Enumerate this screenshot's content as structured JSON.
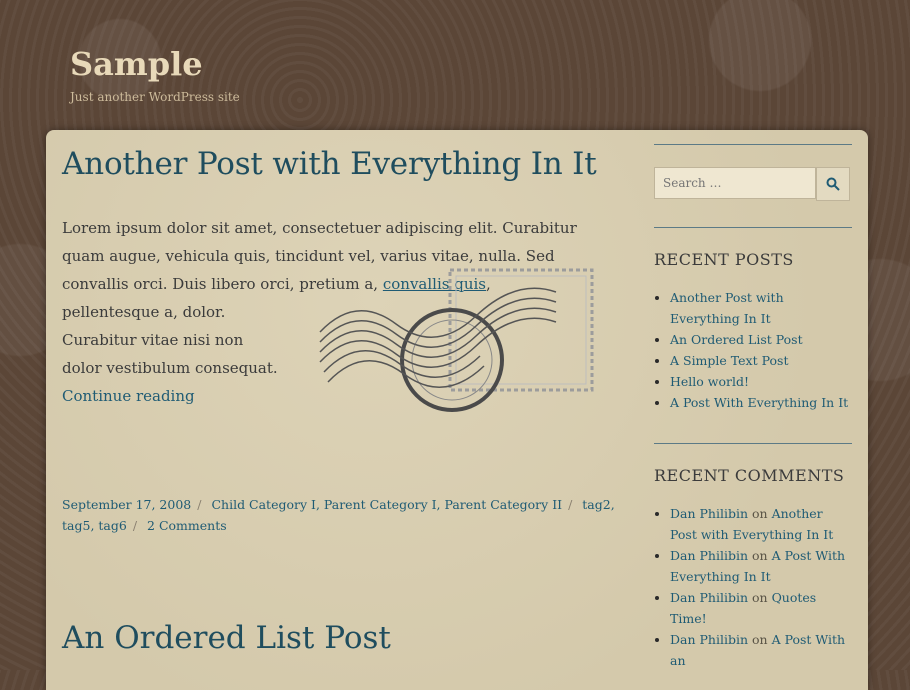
{
  "site": {
    "title": "Sample",
    "description": "Just another WordPress site"
  },
  "post": {
    "title": "Another Post with Everything In It",
    "para_1": "Lorem ipsum dolor sit amet, consectetuer adipiscing elit. Curabitur quam augue, vehicula quis, tincidunt vel, varius vitae, nulla. Sed convallis orci. Duis libero orci, pretium a,",
    "link": "convallis quis",
    "para_2": "pellentesque a, dolor. Curabitur vitae nisi non dolor vestibulum consequat.",
    "continue": "Continue reading",
    "date": "September 17, 2008",
    "categories": [
      "Child Category I",
      "Parent Category I",
      "Parent Category II"
    ],
    "tags": [
      "tag2",
      "tag5",
      "tag6"
    ],
    "comments": "2 Comments"
  },
  "next_post": {
    "title": "An Ordered List Post"
  },
  "search": {
    "placeholder": "Search …"
  },
  "recent_posts": {
    "title": "RECENT POSTS",
    "items": [
      "Another Post with Everything In It",
      "An Ordered List Post",
      "A Simple Text Post",
      "Hello world!",
      "A Post With Everything In It"
    ]
  },
  "recent_comments": {
    "title": "RECENT COMMENTS",
    "items": [
      {
        "author": "Dan Philibin",
        "on": "on",
        "post": "Another Post with Everything In It"
      },
      {
        "author": "Dan Philibin",
        "on": "on",
        "post": "A Post With Everything In It"
      },
      {
        "author": "Dan Philibin",
        "on": "on",
        "post": "Quotes Time!"
      },
      {
        "author": "Dan Philibin",
        "on": "on",
        "post": "A Post With an"
      }
    ]
  }
}
